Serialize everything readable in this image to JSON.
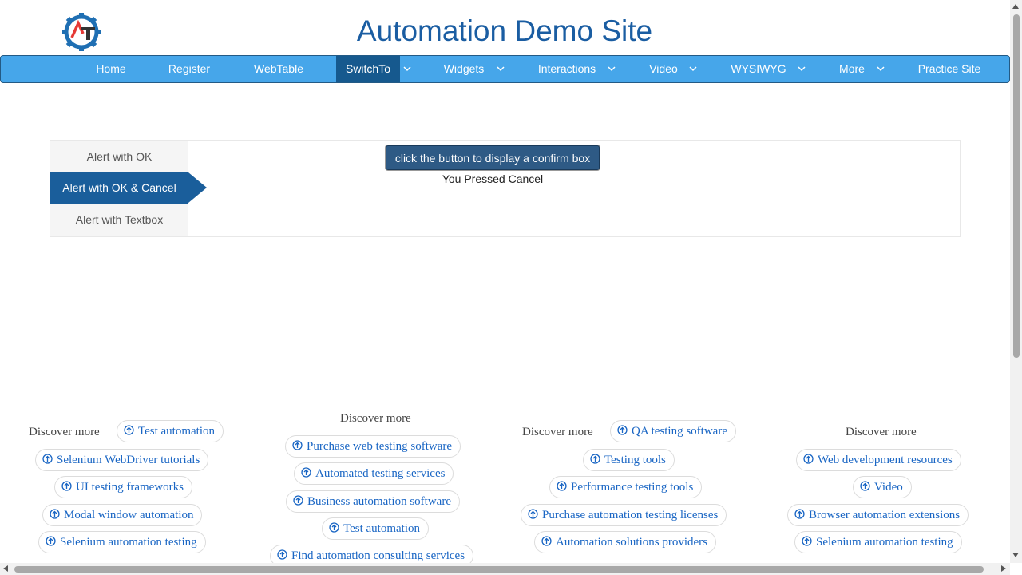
{
  "header": {
    "title": "Automation Demo Site",
    "logo": "AT-gear-logo"
  },
  "nav": {
    "items": [
      {
        "label": "Home"
      },
      {
        "label": "Register"
      },
      {
        "label": "WebTable"
      },
      {
        "label": "SwitchTo",
        "active": true
      },
      {
        "label": "Widgets"
      },
      {
        "label": "Interactions"
      },
      {
        "label": "Video"
      },
      {
        "label": "WYSIWYG"
      },
      {
        "label": "More"
      },
      {
        "label": "Practice Site"
      }
    ]
  },
  "alerts": {
    "tabs": [
      {
        "label": "Alert with OK"
      },
      {
        "label": "Alert with OK & Cancel",
        "active": true
      },
      {
        "label": "Alert with Textbox"
      }
    ],
    "button_label": "click the button to display a confirm box",
    "result_text": "You Pressed Cancel"
  },
  "discover": [
    {
      "label": "Discover more",
      "chips": [
        "Test automation",
        "Selenium WebDriver tutorials",
        "UI testing frameworks",
        "Modal window automation",
        "Selenium automation testing"
      ]
    },
    {
      "label": "Discover more",
      "chips": [
        "Purchase web testing software",
        "Automated testing services",
        "Business automation software",
        "Test automation",
        "Find automation consulting services"
      ]
    },
    {
      "label": "Discover more",
      "chips": [
        "QA testing software",
        "Testing tools",
        "Performance testing tools",
        "Purchase automation testing licenses",
        "Automation solutions providers"
      ]
    },
    {
      "label": "Discover more",
      "chips": [
        "Web development resources",
        "Video",
        "Browser automation extensions",
        "Selenium automation testing"
      ]
    }
  ],
  "colors": {
    "brand": "#1a5da2",
    "nav": "#46a6ea",
    "nav_active": "#16598e",
    "link": "#1a66c4"
  }
}
